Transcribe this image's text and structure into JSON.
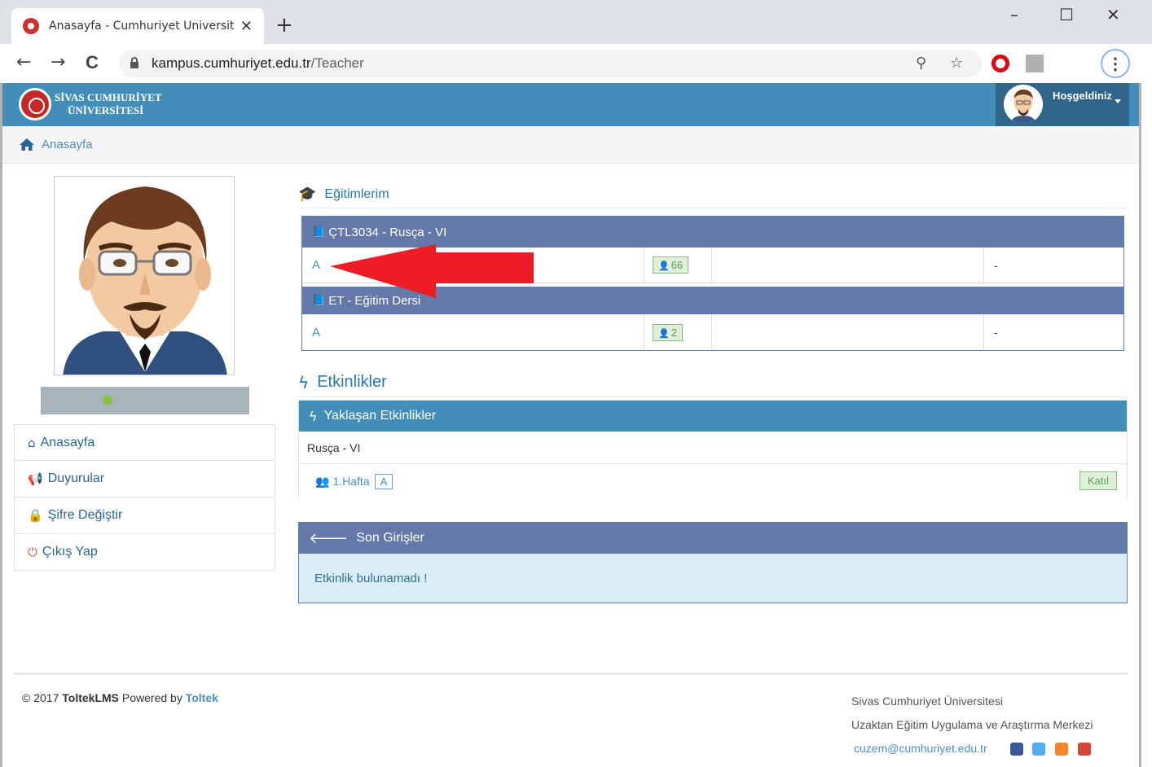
{
  "browser": {
    "tab_title": "Anasayfa - Cumhuriyet Üniversite",
    "tab_close": "✕",
    "new_tab": "+",
    "url_host": "kampus.cumhuriyet.edu.tr",
    "url_path": "/Teacher",
    "back": "←",
    "forward": "→",
    "reload": "C",
    "minimize": "–",
    "maximize": "☐",
    "close": "✕",
    "zoom_icon": "⚲",
    "star_icon": "☆",
    "menu": "⋮"
  },
  "header": {
    "logo_line1": "SİVAS CUMHURİYET",
    "logo_line2": "ÜNİVERSİTESİ",
    "greeting": "Hoşgeldiniz"
  },
  "breadcrumb": {
    "home": "Anasayfa"
  },
  "sidebar": {
    "items": [
      {
        "label": "Anasayfa",
        "icon": "home-icon",
        "glyph": "⌂"
      },
      {
        "label": "Duyurular",
        "icon": "bullhorn-icon",
        "glyph": "📢"
      },
      {
        "label": "Şifre Değiştir",
        "icon": "lock-icon",
        "glyph": "🔒"
      },
      {
        "label": "Çıkış Yap",
        "icon": "power-icon",
        "glyph": "⏻"
      }
    ]
  },
  "courses": {
    "title": "Eğitimlerim",
    "list": [
      {
        "name": "ÇTL3034 - Rusça - VI",
        "group": "A",
        "count": "66",
        "extra": "-"
      },
      {
        "name": "ET - Eğitim Dersi",
        "group": "A",
        "count": "2",
        "extra": "-"
      }
    ]
  },
  "events": {
    "title": "Etkinlikler",
    "upcoming_title": "Yaklaşan Etkinlikler",
    "course": "Rusça - VI",
    "week": "1.Hafta",
    "group": "A",
    "join": "Katıl"
  },
  "logins": {
    "title": "Son Girişler",
    "empty": "Etkinlik bulunamadı !"
  },
  "footer": {
    "copyright_prefix": "© 2017 ",
    "product": "ToltekLMS",
    "powered": " Powered by ",
    "brand": "Toltek",
    "org_line1": "Sivas Cumhuriyet Üniversitesi",
    "org_line2": "Uzaktan Eğitim Uygulama ve Araştırma Merkezi",
    "email": "cuzem@cumhuriyet.edu.tr"
  },
  "colors": {
    "header_blue": "#438eb9",
    "panel_purple": "#6379aa",
    "link_blue": "#4c8fbd",
    "arrow_red": "#ee1c25",
    "badge_green": "#629b58"
  }
}
